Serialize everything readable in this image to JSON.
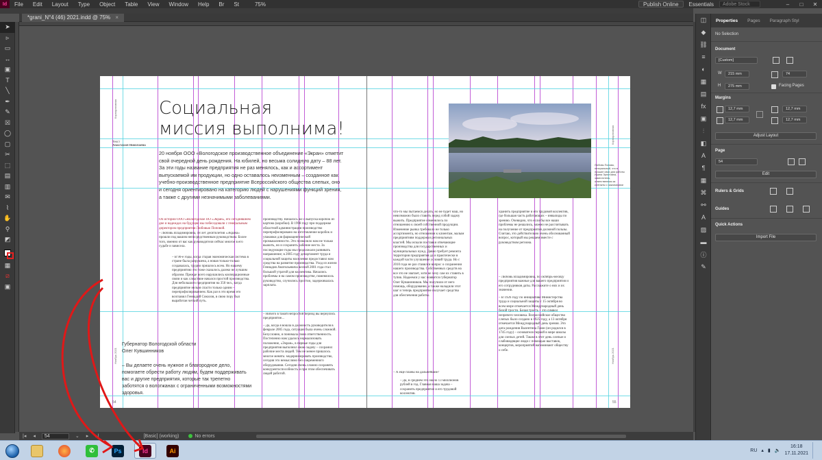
{
  "menubar": {
    "app_logo": "Id",
    "items": [
      "File",
      "Edit",
      "Layout",
      "Type",
      "Object",
      "Table",
      "View",
      "Window",
      "Help"
    ],
    "br_badge": "Br",
    "st_badge": "St",
    "zoom": "75%",
    "publish": "Publish Online",
    "workspace": "Essentials",
    "search_placeholder": "Adobe Stock"
  },
  "document": {
    "tab_title": "*grani_N°4 (46) 2021.indd @ 75%",
    "close": "×",
    "headline_line1": "Социальная",
    "headline_line2": "миссия выполнима!",
    "byline_label": "Текст",
    "byline_name": "Анастасия Николаева",
    "running_head_left": "Корпоративная",
    "running_head_right": "Корпоративная",
    "lead": "20 ноября ООО «Вологодское производственное объединение «Экран» отметит свой очередной день рождения. На юбилей, но весьма солидную дату – 88 лет. За эти годы название предприятия не раз менялось, как и ассортимент выпускаемой им продукции, но одно оставалось неизменным – созданное как учебно-производственное предприятие Всероссийского общества слепых, оно и сегодня ориентировано на категорию людей с нарушениями функций зрения, а также с другими незначимыми заболеваниями.",
    "col1_intro": "Об истории ООО «Вологодское ПО «Экран», его сегодняшнем дне и надеждах на будущее мы побеседовали с генеральным директором предприятия Любовью Поповой.",
    "col1_question": "– Любовь Владимировна, 18 лет десятилетия «Экрана» прошли под вашим непосредственным руководством. Более того, именно от вас как руководителя сейчас многое в его судьбе и зависела.",
    "col1_body": "– В 90-е годы, когда старая экономическая система в стране была разрушена, а новая только-только создавалась, трудно пришлось всем. Но нашему предприятию это тоже сказалось далеко не лучшим образом. Прежде всего нарушились кооперационные связи и как следствие начался простой производства. Для небольшого предприятия на 350 чел., когда предприятие нельзя спасти только одним – перепрофилированием. Как раз в это время его возглавил Геннадий Соколов, в свою пору был выработан четкий путь.",
    "col2_body": "производству. Началось же с выпуска коробок из картона (коробки). В 1998 году при поддержке областной администрации производство перепрофилировано на изготовление коробок и упаковки для фармацевтической промышленности. Это позволило нам не только выжить, но и сохранить рабочие места. За последующие годы мы продолжали развивать направление; в 2005 году департамент труда и социальной защиты населения предоставил нам средства на развитие производства. Уход из жизни Геннадия Анатольевича весной 2001 года стал большой утратой для коллектива. Начались проблемы и на самом производстве, поменялось руководство, случились простои, задерживалась зарплата.",
    "col2_question": "– Ничего в такой непростой период вы вернулись предприятие...",
    "col2_body2": "– Да, когда я вошла в должность руководителя в феврале 2005 года, ситуация была очень сложной. Безусловно, я понимала свою ответственность. Постепенно нам удалось нормализовать положение, «Экран», в первые годы для предприятия выполнил свою задачу – сохранил рабочие места людей. Тем не менее пришлось многое менять: модернизировать производство, сегодня это немыслимо без современного оборудования. Сегодня очень сложно сохранять конкурентоспособность и при этом обеспечивать людей работой.",
    "signoff_line1": "Губернатор Вологодской области",
    "signoff_line2": "Олег Кувшинников",
    "signoff_quote": "– Вы делаете очень нужное и благородное дело, помогаете обрести работу людям, будем поддерживать вас и другие предприятия, которые так трепетно заботятся о вологжанах с ограниченными возможностями здоровья.",
    "col3_body": "что-то мы пытаемся делать, но не будет наш, но невозможно было ставить перед собой задачу выжить. Предприятие изменилось по отношению к своей собственной продукции. Изменение рынка требовало не только ассортимента, но отношения к клиентам, малым предприятиям поддержки региональных властей. Мы искали поставки отвечающие производства для государственных и муниципальных нужд. Давно требует ремонта территория предприятия да и практически в каждой части улучшение условий труда. Но с 2010 года не раз ставился вопрос о сохранении нашего производства. Собственных средств на все это не хватает, хотя не хочу сам их ставить в тупик. Надеемся у нас появится губернатор Олег Кувшинников. Мы получили от него помощь, оборудование, а также наладили этот шаг и теперь предприятие получает средства для обеспечения работы.",
    "col3_question": "– А ещё планы на дальнейшие?",
    "col3_body2": "– Да, в среднем это около 13 миллионов рублей в год. Главная наша задача – сохранить предприятие и его трудовой коллектив.",
    "col4_body": "хранить предприятие и его трудовой коллектив, где большая часть работающих – инвалиды по зрению. Очевидно, что если бы все наши проблемы не решались, можно не рассчитывать на получение от предприятия должной пользы. Считаю, это действительно очень обоснованный вопрос, который мы решаем вместе с руководством региона.",
    "col4_question": "– Любовь Владимировна, по октябрь-месяцу предприятия важные для вашего предприятия и его сотрудников даты. Расскажите о них и их значении.",
    "col4_body2": "– В 1926 году по инициативе Министерства труда и социальной защиты с 15 октября во всем мире отмечается Международный день белой трости. Белая трость – это символ незрячего человека. Всероссийское общество слепых было создано в 1925 году, а 13 октября отмечается Международный день зрения. Это дата рождения Валентина Гаюи (он родился в 1745 году) – основателя первой в мире школы для слепых детей. Также в этот день слепые и слабовидящие люди с помощью выставок, концертов, мероприятий напоминают обществу о себе.",
    "photo_caption": "Любовь Попова, генеральный, что в лучшие свои дни работы Ирина Эрнстовна, заместитель, ответственная за контакты с заказчиками",
    "page_left": "54",
    "page_right": "55",
    "right_date": "Ноябрь 2021"
  },
  "status": {
    "page": "54",
    "style": "[Basic] (working)",
    "errors": "No errors"
  },
  "panel": {
    "tabs": [
      "Properties",
      "Pages",
      "Paragraph Styl"
    ],
    "selection": "No Selection",
    "document_label": "Document",
    "preset": "[Custom]",
    "width": "215 mm",
    "height": "275 mm",
    "pages": "74",
    "facing_pages": "Facing Pages",
    "margins_label": "Margins",
    "margin_top": "12,7 mm",
    "margin_bottom": "12,7 mm",
    "margin_inside": "12,7 mm",
    "margin_outside": "12,7 mm",
    "adjust_layout": "Adjust Layout",
    "page_label": "Page",
    "page_value": "54",
    "edit": "Edit",
    "rulers_grids": "Rulers & Grids",
    "guides": "Guides",
    "quick_actions": "Quick Actions",
    "import_file": "Import File",
    "w_label": "W",
    "h_label": "H"
  },
  "taskbar": {
    "ps": "Ps",
    "id": "Id",
    "ai": "Ai",
    "lang": "RU",
    "time": "16:18",
    "date": "17.11.2021"
  }
}
